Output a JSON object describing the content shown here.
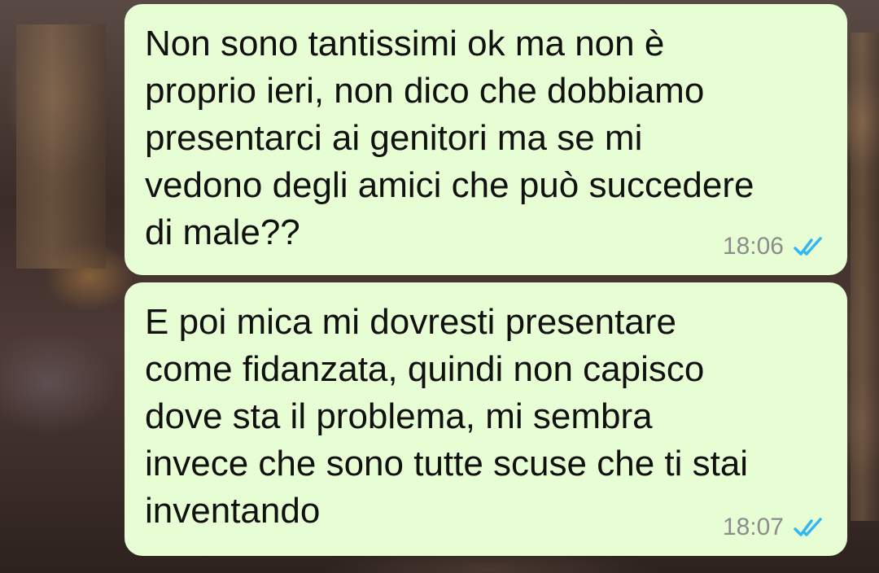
{
  "chat": {
    "messages": [
      {
        "text": "Non sono tantissimi ok ma non è\nproprio ieri, non dico che dobbiamo\npresentarci ai genitori ma se mi\nvedono degli amici che può succedere\ndi male??",
        "time": "18:06",
        "status_icon": "double-check-read-icon"
      },
      {
        "text": "E poi mica mi dovresti presentare\ncome fidanzata, quindi non capisco\ndove sta il problema, mi sembra\ninvece che sono tutte scuse che ti stai\ninventando",
        "time": "18:07",
        "status_icon": "double-check-read-icon"
      }
    ]
  },
  "colors": {
    "bubble_background": "#e7fdd3",
    "read_tick": "#34b7f1",
    "timestamp": "#8c8c8c"
  }
}
